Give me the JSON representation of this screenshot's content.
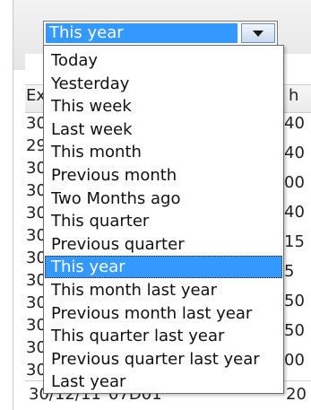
{
  "combo": {
    "selected_value": "This year",
    "button_icon": "chevron-down-icon"
  },
  "dropdown": {
    "selected_index": 9,
    "options": [
      "Today",
      "Yesterday",
      "This week",
      "Last week",
      "This month",
      "Previous month",
      "Two Months ago",
      "This quarter",
      "Previous quarter",
      "This year",
      "This month last year",
      "Previous month last year",
      "This quarter last year",
      "Previous quarter last year",
      "Last year"
    ]
  },
  "background_table": {
    "header_left": "Ex",
    "header_right": "h",
    "left_fragments": [
      "30",
      "29",
      "30",
      "30",
      "30",
      "30",
      "30",
      "30",
      "30",
      "30",
      "30",
      "30"
    ],
    "right_fragments": [
      "40",
      "40",
      "00",
      "40",
      "15",
      "5",
      "50",
      "50",
      "00"
    ],
    "bottom_row": {
      "date": "30/12/11",
      "code": "07D01",
      "value": "20"
    }
  },
  "colors": {
    "selection": "#3399ff",
    "selection_text": "#ffffff"
  }
}
